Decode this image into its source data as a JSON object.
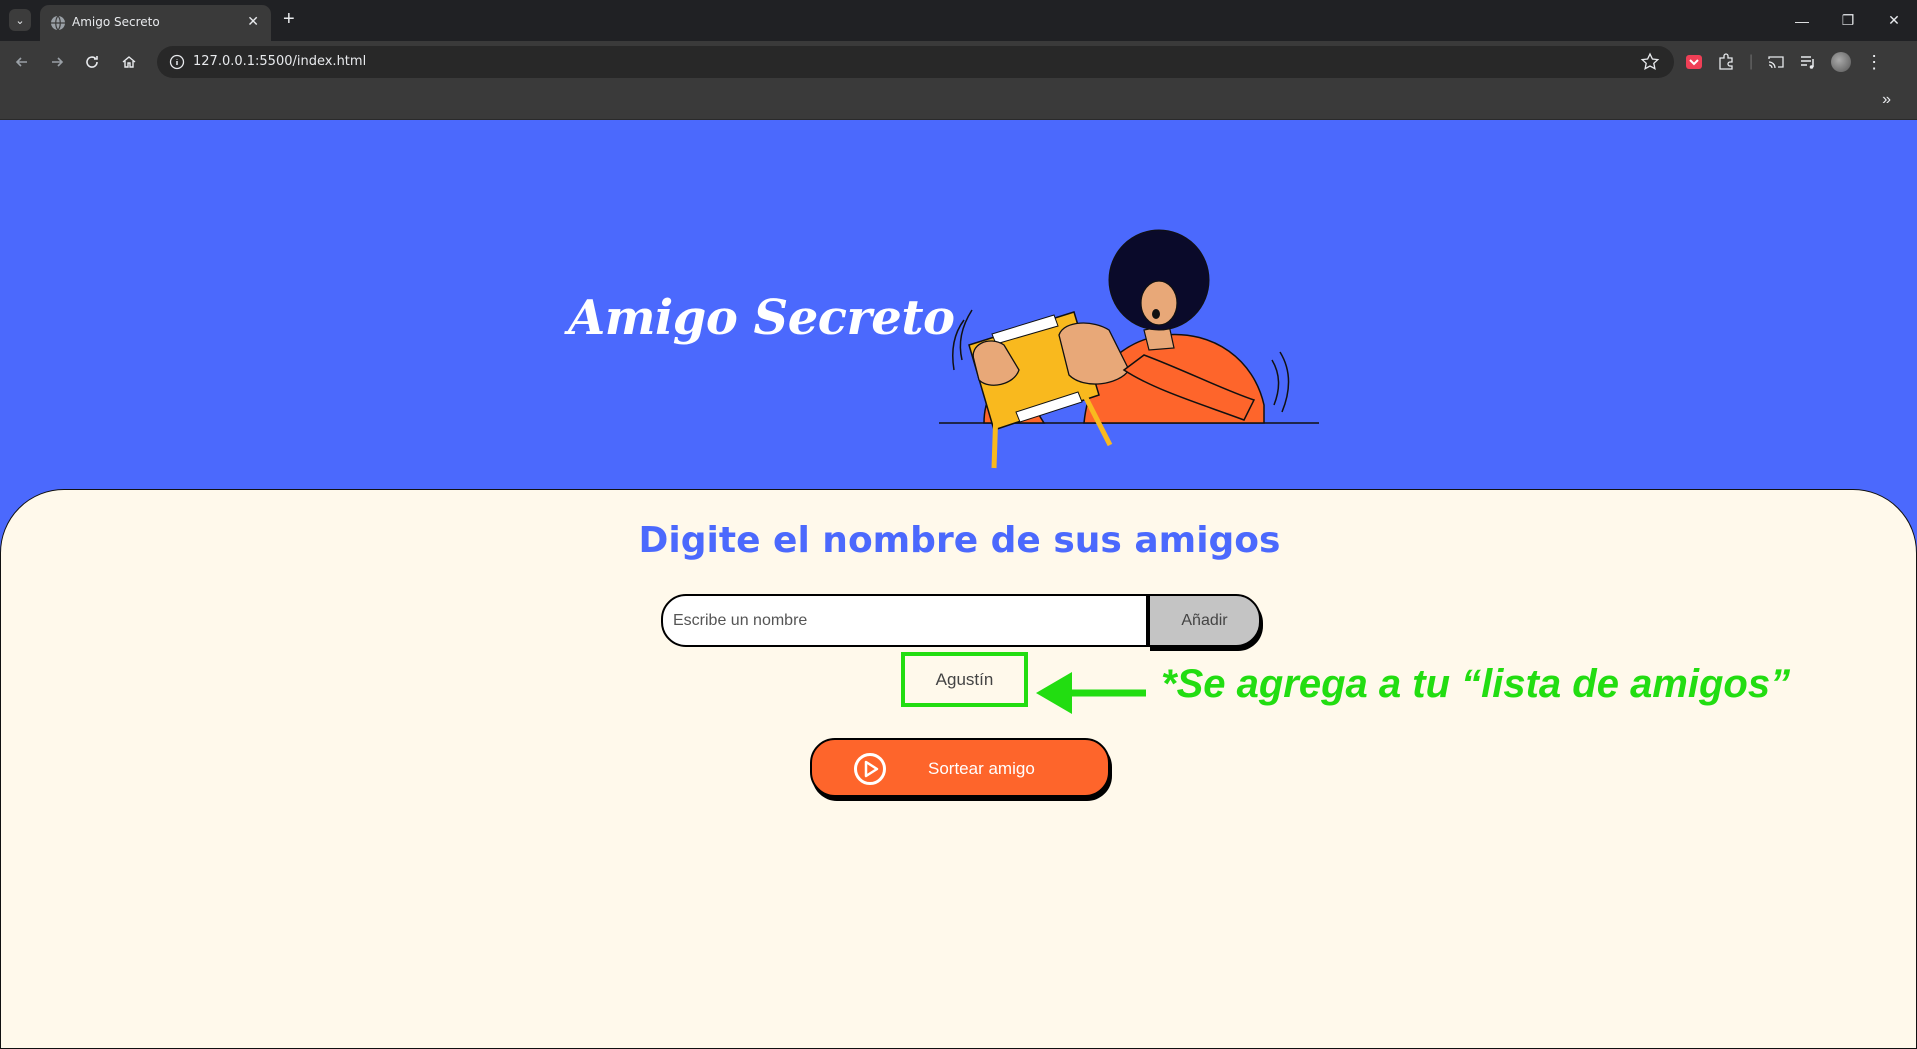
{
  "browser": {
    "tab_title": "Amigo Secreto",
    "new_tab_symbol": "+",
    "url": "127.0.0.1:5500/index.html",
    "bookmarks_overflow": "»"
  },
  "page": {
    "banner_title": "Amigo Secreto",
    "heading": "Digite el nombre de sus amigos",
    "input_placeholder": "Escribe un nombre",
    "input_value": "",
    "add_button": "Añadir",
    "friends": [
      "Agustín"
    ],
    "draw_button": "Sortear amigo",
    "annotation": "*Se agrega a tu “lista de amigos”"
  },
  "colors": {
    "banner_blue": "#4b69fd",
    "card_bg": "#fff9eb",
    "accent_orange": "#fe652b",
    "annotation_green": "#22dd11"
  },
  "icons": {
    "tab_favicon": "globe-icon",
    "back": "arrow-left-icon",
    "forward": "arrow-right-icon",
    "reload": "reload-icon",
    "home": "home-icon",
    "site_info": "info-icon",
    "bookmark": "star-icon",
    "draw": "play-circle-icon"
  }
}
